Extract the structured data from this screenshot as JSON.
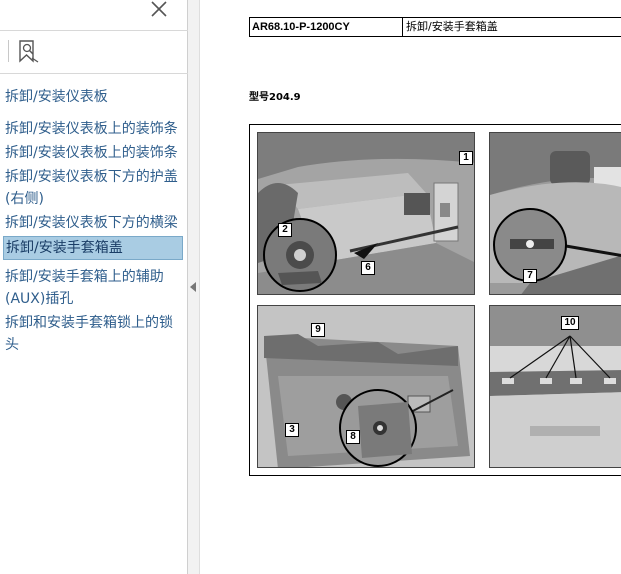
{
  "sidebar": {
    "items": [
      {
        "label": "拆卸/安装仪表板",
        "selected": false
      },
      {
        "label": "拆卸/安装仪表板上的装饰条",
        "selected": false
      },
      {
        "label": "拆卸/安装仪表板上的装饰条",
        "selected": false
      },
      {
        "label": "拆卸/安装仪表板下方的护盖 (右侧)",
        "selected": false
      },
      {
        "label": "拆卸/安装仪表板下方的横梁",
        "selected": false
      },
      {
        "label": "拆卸/安装手套箱盖",
        "selected": true
      },
      {
        "label": "拆卸/安装手套箱上的辅助(AUX)插孔",
        "selected": false
      },
      {
        "label": "拆卸和安装手套箱锁上的锁头",
        "selected": false
      }
    ],
    "selected_color": "#a9cce3",
    "link_color": "#2f5e8c"
  },
  "document": {
    "code": "AR68.10-P-1200CY",
    "title": "拆卸/安装手套箱盖",
    "model": "型号204.9",
    "callouts": {
      "c1": "1",
      "c2": "2",
      "c6": "6",
      "c7": "7",
      "c9": "9",
      "c3": "3",
      "c8": "8",
      "c10": "10"
    }
  },
  "icons": {
    "close": "close-icon",
    "bookmark": "bookmark-search-icon",
    "collapse": "collapse-panel-arrow-icon"
  }
}
